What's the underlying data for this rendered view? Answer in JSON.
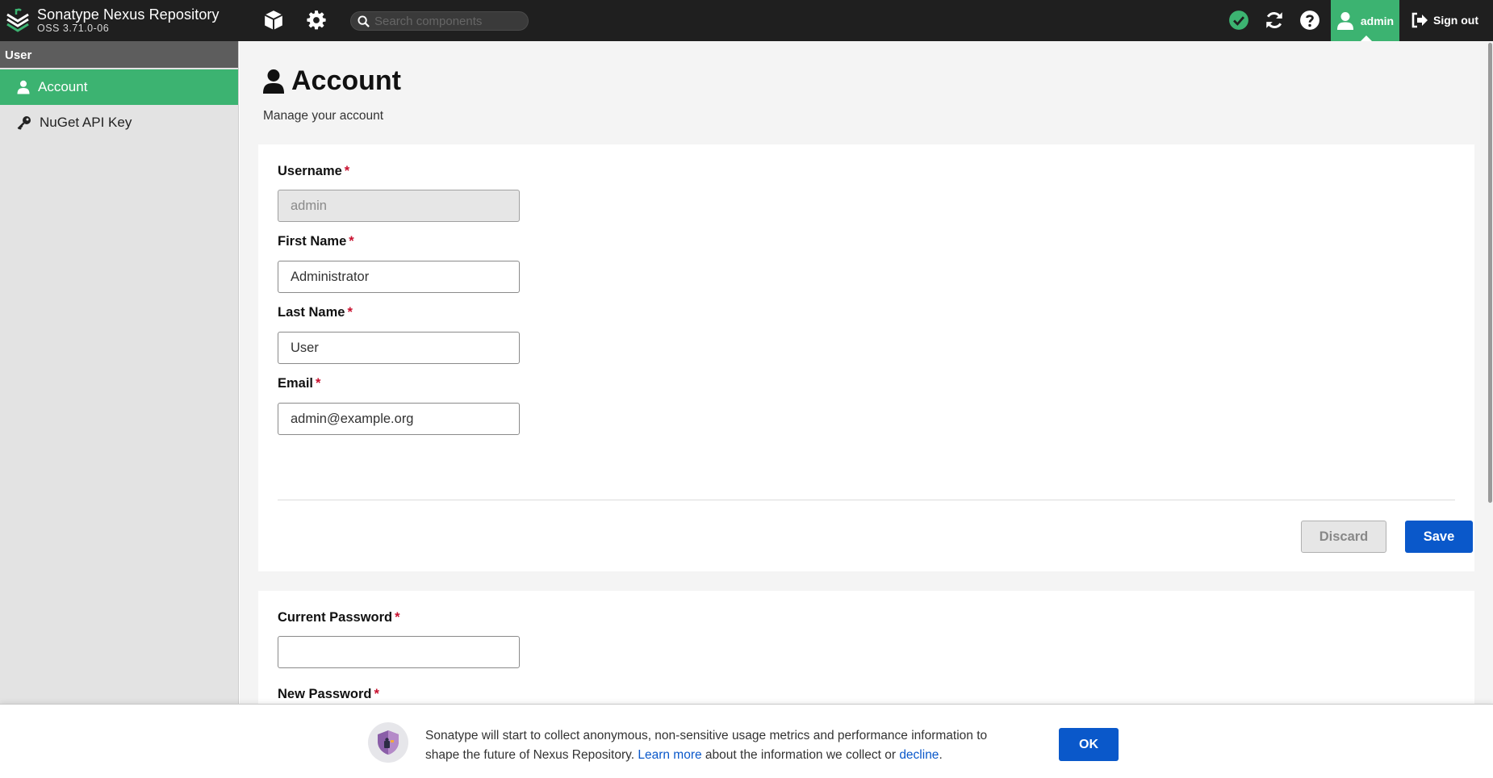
{
  "header": {
    "title": "Sonatype Nexus Repository",
    "version": "OSS 3.71.0-06",
    "search_placeholder": "Search components",
    "user_label": "admin",
    "signout_label": "Sign out",
    "icons": [
      "cube-icon",
      "gear-icon",
      "search-icon",
      "status-ok-icon",
      "refresh-icon",
      "help-icon",
      "user-icon",
      "sign-out-icon"
    ],
    "colors": {
      "bar": "#1f1f1f",
      "accent": "#3cb371"
    }
  },
  "sidebar": {
    "header": "User",
    "items": [
      {
        "label": "Account",
        "icon": "user-icon",
        "active": true
      },
      {
        "label": "NuGet API Key",
        "icon": "key-icon",
        "active": false
      }
    ]
  },
  "main": {
    "title": "Account",
    "subtitle": "Manage your account",
    "account_form": {
      "username": {
        "label": "Username",
        "required": "*",
        "value": "admin"
      },
      "first_name": {
        "label": "First Name",
        "required": "*",
        "value": "Administrator"
      },
      "last_name": {
        "label": "Last Name",
        "required": "*",
        "value": "User"
      },
      "email": {
        "label": "Email",
        "required": "*",
        "value": "admin@example.org"
      },
      "discard_label": "Discard",
      "save_label": "Save"
    },
    "password_form": {
      "current_password": {
        "label": "Current Password",
        "required": "*",
        "value": ""
      },
      "new_password": {
        "label": "New Password",
        "required": "*"
      }
    }
  },
  "banner": {
    "text_before": "Sonatype will start to collect anonymous, non-sensitive usage metrics and performance information to shape the future of Nexus Repository. ",
    "learn_more": "Learn more",
    "text_middle": " about the information we collect or ",
    "decline": "decline",
    "text_after": ".",
    "ok_label": "OK"
  }
}
